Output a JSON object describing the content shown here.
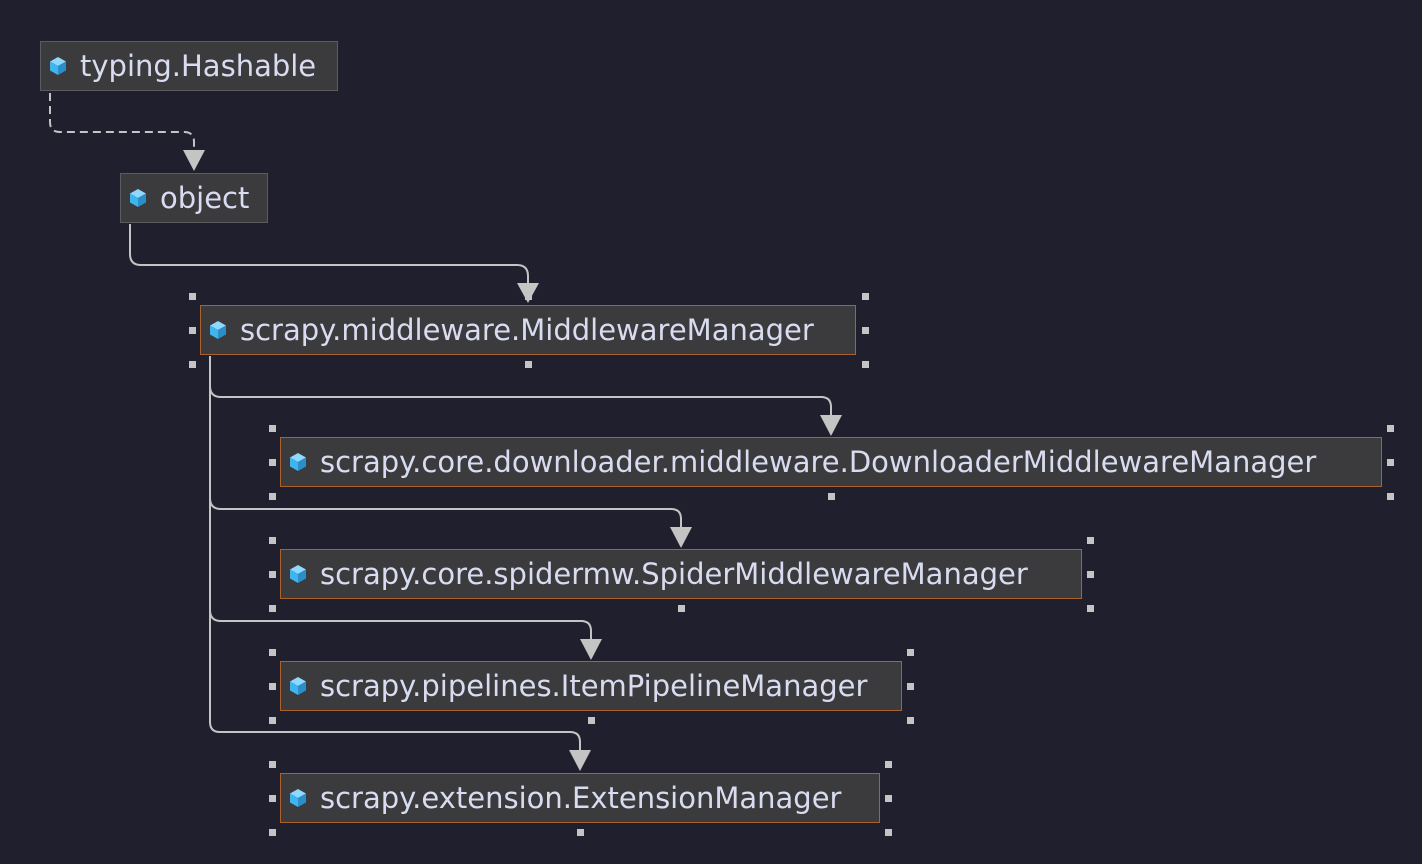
{
  "diagram": {
    "nodes": [
      {
        "id": "hashable",
        "label": "typing.Hashable",
        "selected": false
      },
      {
        "id": "object",
        "label": "object",
        "selected": false
      },
      {
        "id": "middleware_manager",
        "label": "scrapy.middleware.MiddlewareManager",
        "selected": true
      },
      {
        "id": "downloader_mw_manager",
        "label": "scrapy.core.downloader.middleware.DownloaderMiddlewareManager",
        "selected": true
      },
      {
        "id": "spider_mw_manager",
        "label": "scrapy.core.spidermw.SpiderMiddlewareManager",
        "selected": true
      },
      {
        "id": "item_pipeline_manager",
        "label": "scrapy.pipelines.ItemPipelineManager",
        "selected": true
      },
      {
        "id": "extension_manager",
        "label": "scrapy.extension.ExtensionManager",
        "selected": true
      }
    ],
    "edges": [
      {
        "from": "hashable",
        "to": "object",
        "style": "dashed"
      },
      {
        "from": "object",
        "to": "middleware_manager",
        "style": "solid"
      },
      {
        "from": "middleware_manager",
        "to": "downloader_mw_manager",
        "style": "solid"
      },
      {
        "from": "middleware_manager",
        "to": "spider_mw_manager",
        "style": "solid"
      },
      {
        "from": "middleware_manager",
        "to": "item_pipeline_manager",
        "style": "solid"
      },
      {
        "from": "middleware_manager",
        "to": "extension_manager",
        "style": "solid"
      }
    ],
    "icon": "class-cube-icon",
    "colors": {
      "background": "#1f1f2d",
      "node_fill": "#3b3b3e",
      "node_border": "#5c5c60",
      "selected_border": "#a8622f",
      "text": "#d9dcf0",
      "edge": "#c4c4c4",
      "icon": "#3fb5ef"
    }
  }
}
